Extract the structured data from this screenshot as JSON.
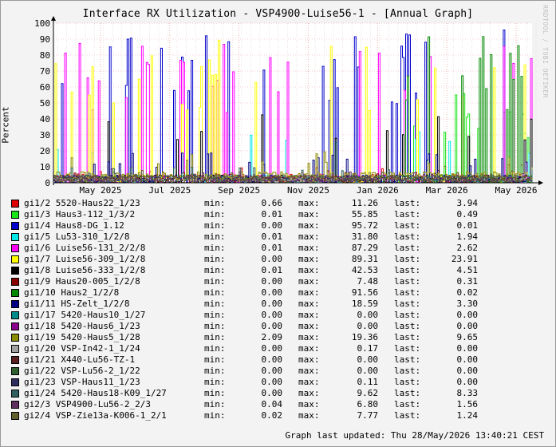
{
  "chart_data": {
    "type": "line",
    "title": "Interface RX Utilization - VSP4900-Luise56-1 - [Annual Graph]",
    "ylabel": "Percent",
    "ylim": [
      0,
      100
    ],
    "y_ticks": [
      "0",
      "10",
      "20",
      "30",
      "40",
      "50",
      "60",
      "70",
      "80",
      "90",
      "100"
    ],
    "x_ticks": [
      "May 2025",
      "Jul 2025",
      "Sep 2025",
      "Nov 2025",
      "Jan 2026",
      "Mar 2026",
      "May 2026"
    ],
    "grid": true,
    "legend_placement": "bottom",
    "series": [
      {
        "name": "gi1/2 5520-Haus22_1/23",
        "color": "#e00000",
        "min": "0.66",
        "max": "11.26",
        "last": "3.94"
      },
      {
        "name": "gi1/3 Haus3-112_1/3/2",
        "color": "#19e619",
        "min": "0.01",
        "max": "55.85",
        "last": "0.49"
      },
      {
        "name": "gi1/4 Haus8-DG_1.12",
        "color": "#0000cc",
        "min": "0.00",
        "max": "95.72",
        "last": "0.01"
      },
      {
        "name": "gi1/5 Lu53-310_1/2/8",
        "color": "#00e6e6",
        "min": "0.01",
        "max": "31.80",
        "last": "1.94"
      },
      {
        "name": "gi1/6 Luise56-131_2/2/8",
        "color": "#ff00ff",
        "min": "0.01",
        "max": "87.29",
        "last": "2.62"
      },
      {
        "name": "gi1/7 Luise56-309_1/2/8",
        "color": "#ffff00",
        "min": "0.00",
        "max": "89.31",
        "last": "23.91"
      },
      {
        "name": "gi1/8 Luise56-333_1/2/8",
        "color": "#000000",
        "min": "0.01",
        "max": "42.53",
        "last": "4.51"
      },
      {
        "name": "gi1/9 Haus20-005_1/2/8",
        "color": "#880000",
        "min": "0.00",
        "max": "7.48",
        "last": "0.31"
      },
      {
        "name": "gi1/10 Haus2_1/2/8",
        "color": "#008800",
        "min": "0.00",
        "max": "91.56",
        "last": "0.02"
      },
      {
        "name": "gi1/11 HS-Zelt_1/2/8",
        "color": "#000080",
        "min": "0.00",
        "max": "18.59",
        "last": "3.30"
      },
      {
        "name": "gi1/17 5420-Haus10_1/27",
        "color": "#008b8b",
        "min": "0.00",
        "max": "0.00",
        "last": "0.00"
      },
      {
        "name": "gi1/18 5420-Haus6_1/23",
        "color": "#8b008b",
        "min": "0.00",
        "max": "0.00",
        "last": "0.00"
      },
      {
        "name": "gi1/19 5420-Haus5_1/28",
        "color": "#8b8b00",
        "min": "2.09",
        "max": "19.36",
        "last": "9.65"
      },
      {
        "name": "gi1/20 VSP-In42-1_1/24",
        "color": "#a0a0a0",
        "min": "0.00",
        "max": "0.17",
        "last": "0.00"
      },
      {
        "name": "gi1/21 X440-Lu56-TZ-1",
        "color": "#5a2020",
        "min": "0.00",
        "max": "0.00",
        "last": "0.00"
      },
      {
        "name": "gi1/22 VSP-Lu56-2_1/22",
        "color": "#2f5f2f",
        "min": "0.00",
        "max": "0.00",
        "last": "0.00"
      },
      {
        "name": "gi1/23 VSP-Haus11_1/23",
        "color": "#2f2f5f",
        "min": "0.00",
        "max": "0.11",
        "last": "0.00"
      },
      {
        "name": "gi1/24 5420-Haus18-K09_1/27",
        "color": "#2f5f5f",
        "min": "0.00",
        "max": "9.62",
        "last": "8.33"
      },
      {
        "name": "gi2/3 VSP4900-Lu56-2_2/3",
        "color": "#5f2f5f",
        "min": "0.04",
        "max": "6.80",
        "last": "1.56"
      },
      {
        "name": "gi2/4 VSP-Zie13a-K006-1_2/1",
        "color": "#5f5f2f",
        "min": "0.02",
        "max": "7.77",
        "last": "1.24"
      }
    ],
    "labels": {
      "min": "min:",
      "max": "max:",
      "last": "last:"
    }
  },
  "footer": {
    "updated": "Graph last updated: Thu 28/May/2026 13:40:21 CEST"
  },
  "watermark": "RRDTOOL / TOBI OETIKER"
}
